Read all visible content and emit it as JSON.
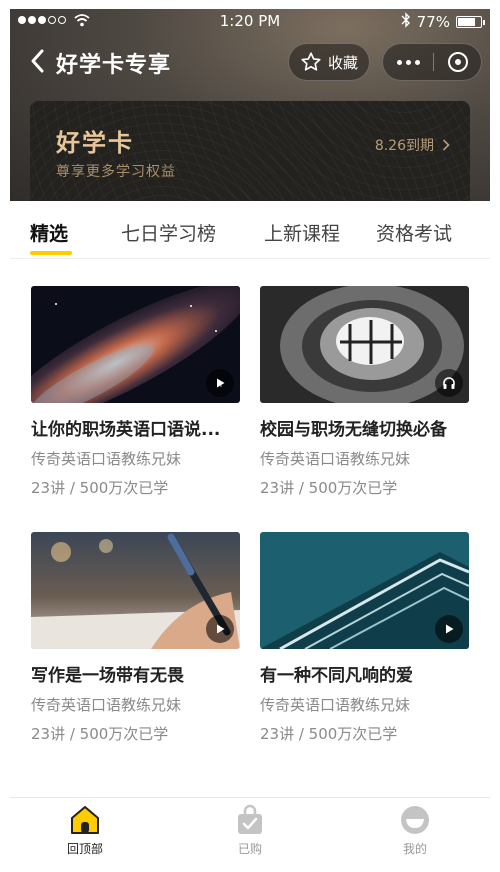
{
  "status_bar": {
    "time": "1:20 PM",
    "battery": "77%"
  },
  "nav": {
    "title": "好学卡专享",
    "collect_label": "收藏"
  },
  "card": {
    "title": "好学卡",
    "subtitle": "尊享更多学习权益",
    "expire": "8.26到期"
  },
  "tabs": [
    {
      "label": "精选",
      "active": true
    },
    {
      "label": "七日学习榜",
      "active": false
    },
    {
      "label": "上新课程",
      "active": false
    },
    {
      "label": "资格考试",
      "active": false
    }
  ],
  "courses": [
    {
      "title": "让你的职场英语口语说...",
      "author": "传奇英语口语教练兄妹",
      "stats": "23讲 / 500万次已学",
      "media": "play-icon"
    },
    {
      "title": "校园与职场无缝切换必备",
      "author": "传奇英语口语教练兄妹",
      "stats": "23讲 / 500万次已学",
      "media": "headphones-icon"
    },
    {
      "title": "写作是一场带有无畏",
      "author": "传奇英语口语教练兄妹",
      "stats": "23讲 / 500万次已学",
      "media": "play-icon"
    },
    {
      "title": "有一种不同凡响的爱",
      "author": "传奇英语口语教练兄妹",
      "stats": "23讲 / 500万次已学",
      "media": "play-icon"
    }
  ],
  "tabbar": [
    {
      "label": "回顶部",
      "icon": "home-icon",
      "active": true
    },
    {
      "label": "已购",
      "icon": "bag-icon",
      "active": false
    },
    {
      "label": "我的",
      "icon": "profile-icon",
      "active": false
    }
  ],
  "colors": {
    "accent": "#ffcc00",
    "card_gold": "#e7c79a"
  }
}
